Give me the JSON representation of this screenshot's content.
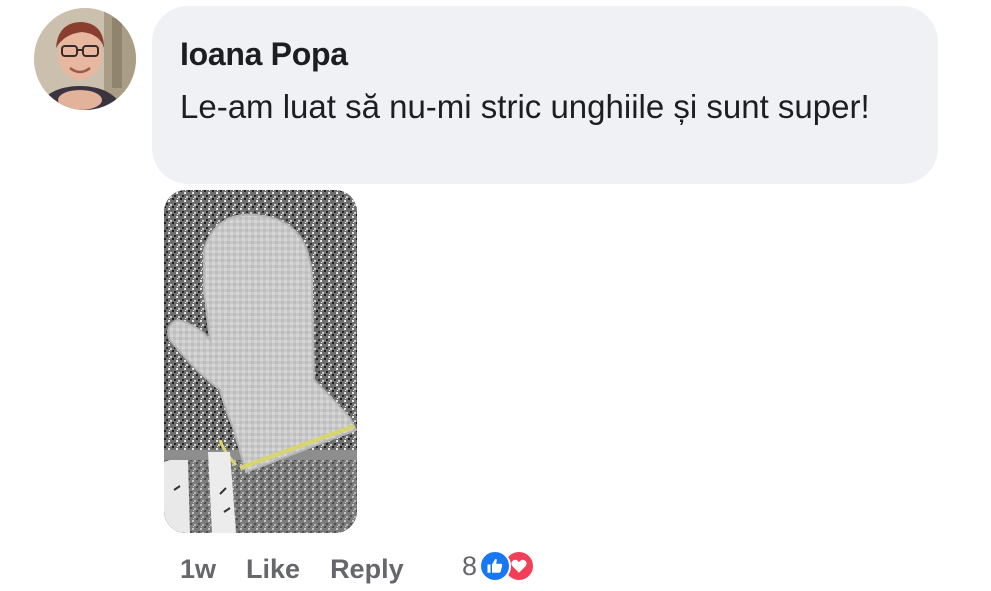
{
  "comment": {
    "author": "Ioana Popa",
    "text": "Le-am luat să nu-mi stric unghiile și sunt super!",
    "time": "1w",
    "like_label": "Like",
    "reply_label": "Reply",
    "reaction_count": "8",
    "reactions": [
      "like-icon",
      "love-icon"
    ]
  },
  "colors": {
    "bubble": "#eff1f4",
    "meta_text": "#65676b",
    "like_blue": "#1877f2",
    "love_red": "#f33e58"
  }
}
